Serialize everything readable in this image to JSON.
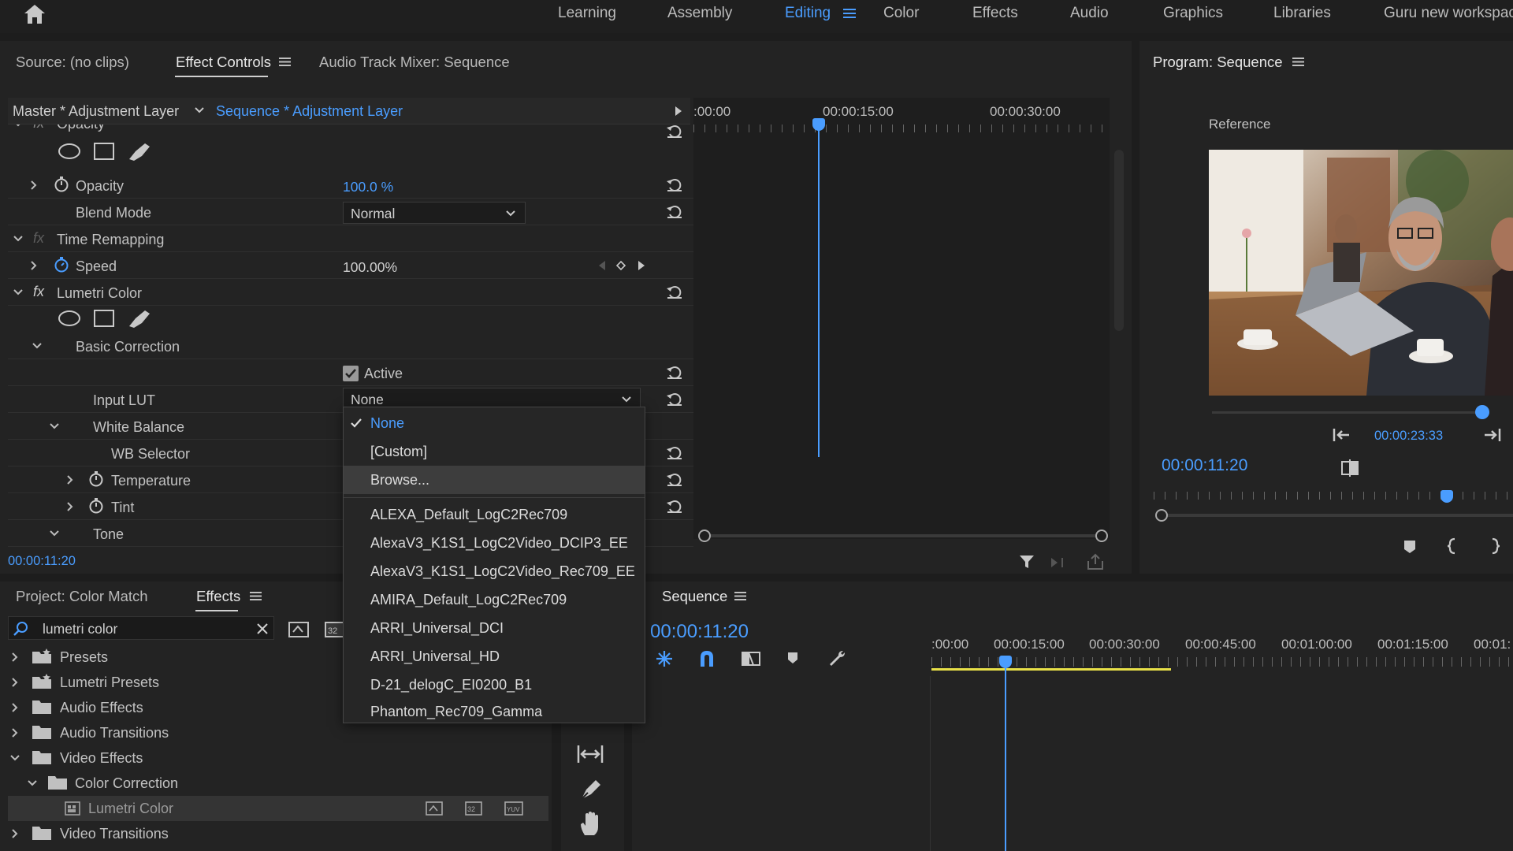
{
  "workspaces": {
    "tabs": [
      "Learning",
      "Assembly",
      "Editing",
      "Color",
      "Effects",
      "Audio",
      "Graphics",
      "Libraries",
      "Guru new workspace"
    ],
    "active": "Editing"
  },
  "source_panel": {
    "tabs": {
      "source": "Source: (no clips)",
      "effect_controls": "Effect Controls",
      "audio_mixer": "Audio Track Mixer: Sequence"
    },
    "master_clip": "Master * Adjustment Layer",
    "sequence_clip": "Sequence * Adjustment Layer",
    "ruler": {
      "t0": ":00:00",
      "t1": "00:00:15:00",
      "t2": "00:00:30:00"
    },
    "timecode": "00:00:11:20"
  },
  "effects": {
    "opacity_section": "Opacity",
    "opacity_label": "Opacity",
    "opacity_value": "100.0 %",
    "blend_label": "Blend Mode",
    "blend_value": "Normal",
    "time_remap": "Time Remapping",
    "speed_label": "Speed",
    "speed_value": "100.00%",
    "lumetri": "Lumetri Color",
    "basic_correction": "Basic Correction",
    "active_label": "Active",
    "input_lut_label": "Input LUT",
    "input_lut_value": "None",
    "white_balance": "White Balance",
    "wb_selector": "WB Selector",
    "temperature": "Temperature",
    "tint": "Tint",
    "tone": "Tone"
  },
  "lut_dropdown": {
    "items": [
      "None",
      "[Custom]",
      "Browse...",
      "ALEXA_Default_LogC2Rec709",
      "AlexaV3_K1S1_LogC2Video_DCIP3_EE",
      "AlexaV3_K1S1_LogC2Video_Rec709_EE",
      "AMIRA_Default_LogC2Rec709",
      "ARRI_Universal_DCI",
      "ARRI_Universal_HD",
      "D-21_delogC_EI0200_B1",
      "Phantom_Rec709_Gamma"
    ],
    "selected": "None",
    "hovered": "Browse..."
  },
  "program_monitor": {
    "title": "Program: Sequence",
    "reference": "Reference",
    "timecode": "00:00:11:20",
    "duration": "00:00:23:33"
  },
  "project_panel": {
    "tabs": {
      "project": "Project: Color Match",
      "effects": "Effects"
    },
    "search_value": "lumetri color",
    "tree": [
      {
        "label": "Presets",
        "indent": 0,
        "expanded": false
      },
      {
        "label": "Lumetri Presets",
        "indent": 0,
        "expanded": false
      },
      {
        "label": "Audio Effects",
        "indent": 0,
        "expanded": false
      },
      {
        "label": "Audio Transitions",
        "indent": 0,
        "expanded": false
      },
      {
        "label": "Video Effects",
        "indent": 0,
        "expanded": true
      },
      {
        "label": "Color Correction",
        "indent": 1,
        "expanded": true
      },
      {
        "label": "Lumetri Color",
        "indent": 2,
        "expanded": false
      },
      {
        "label": "Video Transitions",
        "indent": 0,
        "expanded": false
      }
    ]
  },
  "timeline": {
    "title": "Sequence",
    "timecode": "00:00:11:20",
    "ruler": [
      ":00:00",
      "00:00:15:00",
      "00:00:30:00",
      "00:00:45:00",
      "00:01:00:00",
      "00:01:15:00",
      "00:01:"
    ]
  },
  "colors": {
    "accent": "#4a9dff",
    "panel": "#232323",
    "background": "#1d1d1d",
    "work_area": "#e8e048"
  }
}
